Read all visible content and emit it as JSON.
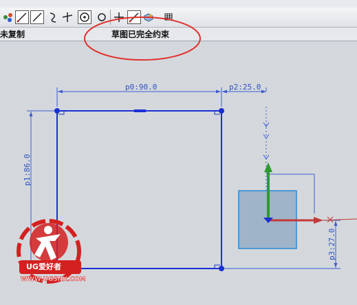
{
  "toolbar": {
    "buttons": [
      "snap-point-icon",
      "line-icon",
      "line-icon-2",
      "arc-icon",
      "derived-line-icon",
      "circle-icon",
      "offset-icon",
      "point-icon",
      "quick-trim-icon",
      "shaded-view-icon",
      "grid-icon"
    ]
  },
  "status": {
    "left_text": "未复制",
    "center_text": "草图已完全约束"
  },
  "sketch": {
    "dim_width": "p0:90.0",
    "dim_height": "p1:86.0",
    "dim_offset_x": "p2:25.0",
    "dim_offset_y": "p3:27.0"
  },
  "watermark": {
    "brand": "UG爱好者",
    "url": "WWW.UGSNX.COM"
  },
  "colors": {
    "sketch_blue": "#1a2fd4",
    "dim_blue": "#3c5bd2",
    "annotation_red": "#e0302c",
    "axis_green": "#2f9a2f",
    "axis_red": "#c43838"
  }
}
